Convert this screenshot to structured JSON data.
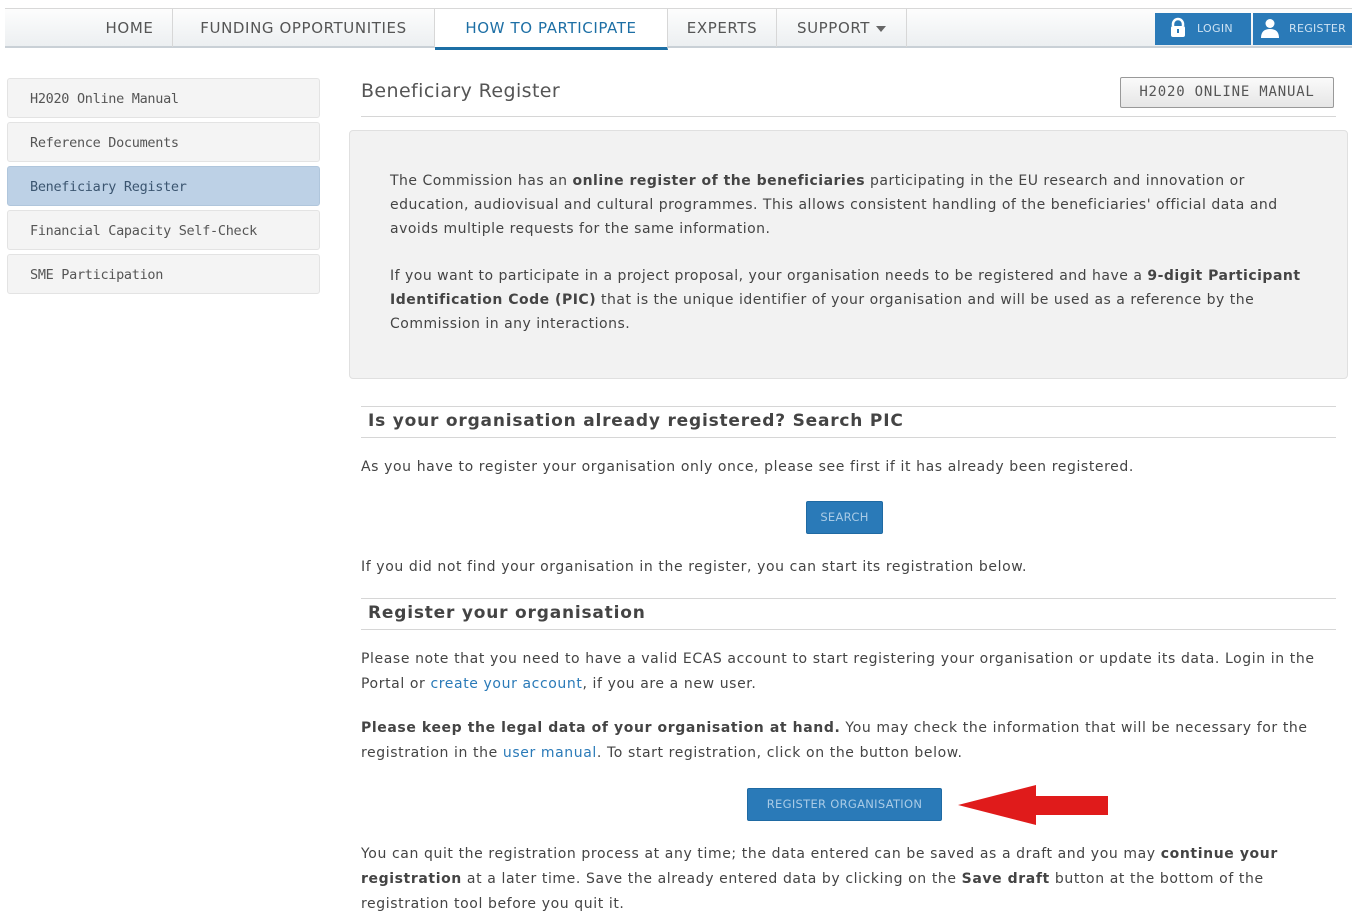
{
  "nav": {
    "items": [
      {
        "label": "HOME"
      },
      {
        "label": "FUNDING OPPORTUNITIES"
      },
      {
        "label": "HOW TO PARTICIPATE"
      },
      {
        "label": "EXPERTS"
      },
      {
        "label": "SUPPORT"
      }
    ],
    "active": "HOW TO PARTICIPATE",
    "login_label": "LOGIN",
    "register_label": "REGISTER"
  },
  "sidebar": {
    "items": [
      {
        "label": "H2020 Online Manual"
      },
      {
        "label": "Reference Documents"
      },
      {
        "label": "Beneficiary Register"
      },
      {
        "label": "Financial Capacity Self-Check"
      },
      {
        "label": "SME Participation"
      }
    ],
    "active": "Beneficiary Register"
  },
  "main": {
    "title": "Beneficiary Register",
    "manual_button": "H2020 ONLINE MANUAL",
    "intro": {
      "p1_a": "The Commission has an ",
      "p1_b": "online register of the beneficiaries",
      "p1_c": " participating in the EU research and innovation or education, audiovisual and cultural programmes. This allows consistent handling of the beneficiaries' official data and avoids multiple requests for the same information.",
      "p2_a": "If you want to participate in a project proposal, your organisation needs to be registered and have a ",
      "p2_b": "9-digit Participant Identification Code (PIC)",
      "p2_c": " that is the unique identifier of your organisation and will be used as a reference by the Commission in any interactions."
    },
    "search_section": {
      "heading": "Is your organisation already registered? Search PIC",
      "text": "As you have to register your organisation only once, please see first if it has already been registered.",
      "button": "SEARCH",
      "after": "If you did not find your organisation in the register, you can start its registration below."
    },
    "register_section": {
      "heading": "Register your organisation",
      "note_a": "Please note that you need to have a valid ECAS account to start registering your organisation or update its data. Login in the Portal or ",
      "note_link": "create your account",
      "note_b": ", if you are a new user.",
      "legal_bold": "Please keep the legal data of your organisation at hand.",
      "legal_a": " You may check the information that will be necessary for the registration in the ",
      "legal_link": "user manual",
      "legal_b": ". To start registration, click on the button below.",
      "button": "REGISTER ORGANISATION",
      "quit_a": "You can quit the registration process at any time; the data entered can be saved as a draft and you may ",
      "quit_bold1": "continue your registration",
      "quit_b": " at a later time. Save the already entered data by clicking on the ",
      "quit_bold2": "Save draft",
      "quit_c": " button at the bottom of the registration tool before you quit it."
    },
    "arrow_color": "#e01b1b"
  }
}
